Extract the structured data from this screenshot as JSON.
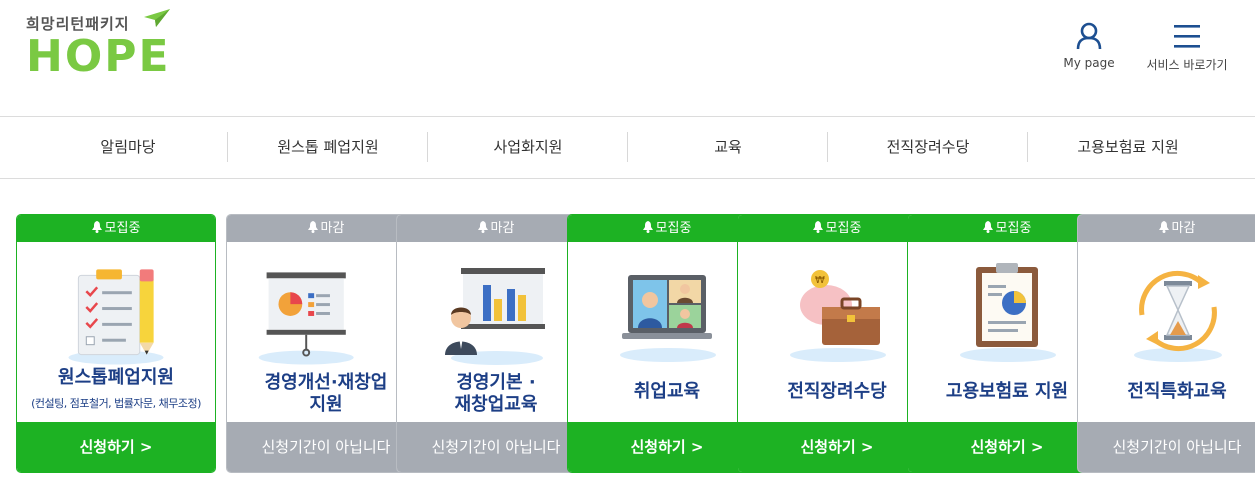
{
  "header": {
    "logo_sub": "희망리턴패키지",
    "logo_main": "HOPE",
    "mypage_label": "My page",
    "service_label": "서비스 바로가기"
  },
  "nav": {
    "items": [
      "알림마당",
      "원스톱 폐업지원",
      "사업화지원",
      "교육",
      "전직장려수당",
      "고용보험료 지원"
    ]
  },
  "cards": [
    {
      "badge": "모집중",
      "title": "원스톱폐업지원",
      "subtitle": "(컨설팅, 점포철거, 법률자문, 채무조정)",
      "button": "신청하기 >",
      "icon": "checklist-icon",
      "status": "open"
    },
    {
      "badge": "마감",
      "title_line1": "경영개선·재창업",
      "title_line2": "지원",
      "button": "신청기간이 아닙니다",
      "icon": "presentation-board-icon",
      "status": "closed"
    },
    {
      "badge": "마감",
      "title_line1": "경영기본 ·",
      "title_line2": "재창업교육",
      "button": "신청기간이 아닙니다",
      "icon": "lecture-chart-icon",
      "status": "closed"
    },
    {
      "badge": "모집중",
      "title": "취업교육",
      "button": "신청하기 >",
      "icon": "video-conference-icon",
      "status": "open"
    },
    {
      "badge": "모집중",
      "title": "전직장려수당",
      "button": "신청하기 >",
      "icon": "piggybank-briefcase-icon",
      "status": "open"
    },
    {
      "badge": "모집중",
      "title": "고용보험료 지원",
      "button": "신청하기 >",
      "icon": "clipboard-pie-icon",
      "status": "open"
    },
    {
      "badge": "마감",
      "title": "전직특화교육",
      "button": "신청기간이 아닙니다",
      "icon": "hourglass-icon",
      "status": "closed"
    }
  ],
  "colors": {
    "open": "#1db223",
    "closed": "#a6abb3",
    "title": "#1d3f86",
    "logo_green": "#7ac943"
  }
}
